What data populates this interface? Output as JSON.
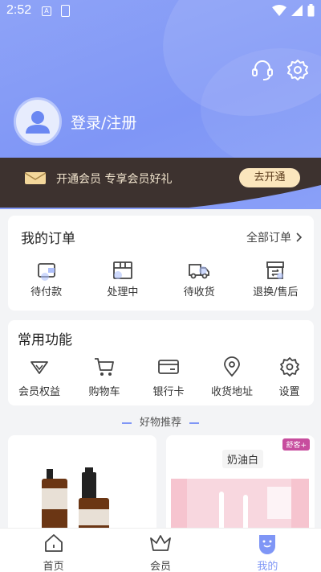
{
  "status_bar": {
    "time": "2:52",
    "icon_a_letter": "A"
  },
  "profile": {
    "login_label": "登录/注册"
  },
  "member_banner": {
    "text": "开通会员 专享会员好礼",
    "button_label": "去开通"
  },
  "orders": {
    "title": "我的订单",
    "all_label": "全部订单",
    "items": [
      {
        "label": "待付款",
        "icon": "wallet-icon"
      },
      {
        "label": "处理中",
        "icon": "box-icon"
      },
      {
        "label": "待收货",
        "icon": "truck-icon"
      },
      {
        "label": "退换/售后",
        "icon": "return-icon"
      }
    ]
  },
  "functions": {
    "title": "常用功能",
    "items": [
      {
        "label": "会员权益",
        "icon": "diamond-icon"
      },
      {
        "label": "购物车",
        "icon": "cart-icon"
      },
      {
        "label": "银行卡",
        "icon": "card-icon"
      },
      {
        "label": "收货地址",
        "icon": "location-icon"
      },
      {
        "label": "设置",
        "icon": "gear-icon"
      }
    ]
  },
  "recommend": {
    "title": "好物推荐"
  },
  "products": [
    {
      "label_text": ""
    },
    {
      "title": "奶油白",
      "brand": "舒客+"
    }
  ],
  "tabbar": {
    "items": [
      {
        "label": "首页",
        "icon": "home-icon",
        "active": false
      },
      {
        "label": "会员",
        "icon": "crown-icon",
        "active": false
      },
      {
        "label": "我的",
        "icon": "face-icon",
        "active": true
      }
    ]
  },
  "colors": {
    "accent": "#7f96f6",
    "header": "#8ea3f7",
    "banner_dark": "#3d322f",
    "banner_button": "#fbe6bd"
  }
}
